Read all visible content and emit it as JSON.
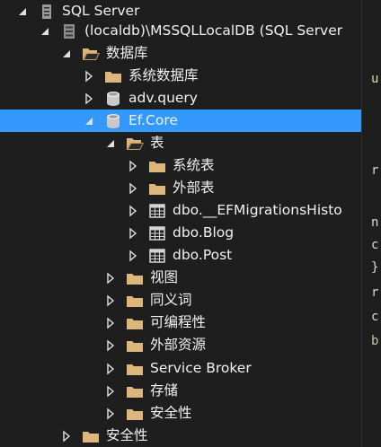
{
  "tree": {
    "nodes": [
      {
        "label": "SQL Server",
        "icon": "server-icon",
        "expander": "collapse"
      },
      {
        "label": "(localdb)\\MSSQLLocalDB (SQL Server",
        "icon": "database-server-icon",
        "expander": "collapse"
      },
      {
        "label": "数据库",
        "icon": "folder-open-icon",
        "expander": "collapse"
      },
      {
        "label": "系统数据库",
        "icon": "folder-icon",
        "expander": "expand"
      },
      {
        "label": "adv.query",
        "icon": "database-icon",
        "expander": "expand"
      },
      {
        "label": "Ef.Core",
        "icon": "database-icon",
        "expander": "collapse",
        "selected": true
      },
      {
        "label": "表",
        "icon": "folder-open-icon",
        "expander": "collapse"
      },
      {
        "label": "系统表",
        "icon": "folder-icon",
        "expander": "expand"
      },
      {
        "label": "外部表",
        "icon": "folder-icon",
        "expander": "expand"
      },
      {
        "label": "dbo.__EFMigrationsHisto",
        "icon": "table-icon",
        "expander": "expand"
      },
      {
        "label": "dbo.Blog",
        "icon": "table-icon",
        "expander": "expand"
      },
      {
        "label": "dbo.Post",
        "icon": "table-icon",
        "expander": "expand"
      },
      {
        "label": "视图",
        "icon": "folder-icon",
        "expander": "expand"
      },
      {
        "label": "同义词",
        "icon": "folder-icon",
        "expander": "expand"
      },
      {
        "label": "可编程性",
        "icon": "folder-icon",
        "expander": "expand"
      },
      {
        "label": "外部资源",
        "icon": "folder-icon",
        "expander": "expand"
      },
      {
        "label": "Service Broker",
        "icon": "folder-icon",
        "expander": "expand"
      },
      {
        "label": "存储",
        "icon": "folder-icon",
        "expander": "expand"
      },
      {
        "label": "安全性",
        "icon": "folder-icon",
        "expander": "expand"
      },
      {
        "label": "安全性",
        "icon": "folder-icon",
        "expander": "expand"
      }
    ]
  },
  "editor_strip": {
    "fragments": [
      {
        "text": "u",
        "color": "#dcdcaa"
      },
      {
        "text": "r",
        "color": "#dcdcdc"
      },
      {
        "text": "n",
        "color": "#dcdcdc"
      },
      {
        "text": "c",
        "color": "#dcdcdc"
      },
      {
        "text": "}",
        "color": "#dcdcdc"
      },
      {
        "text": "r",
        "color": "#dcdcdc"
      },
      {
        "text": "c",
        "color": "#dcdcdc"
      },
      {
        "text": "b",
        "color": "#b5cea8"
      }
    ]
  },
  "colors": {
    "background": "#1e1e1e",
    "selection": "#3399ff",
    "text": "#f1f1f1",
    "folder": "#dcb67a",
    "database": "#c9c9c9"
  }
}
